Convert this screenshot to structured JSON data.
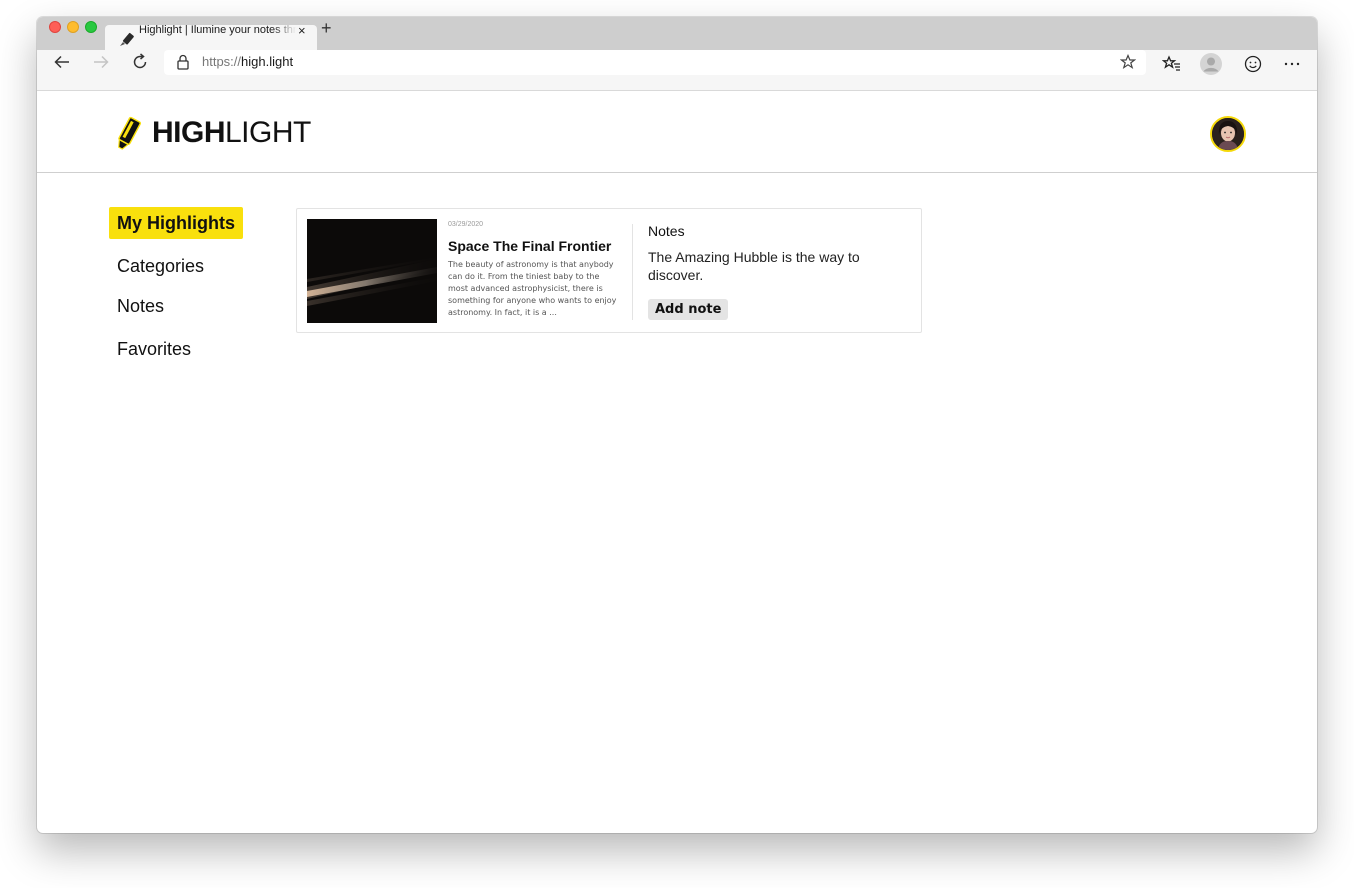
{
  "browser": {
    "tab": {
      "title": "Highlight | Ilumine your notes through your highlights",
      "close_glyph": "×"
    },
    "new_tab_glyph": "+",
    "address": {
      "scheme": "https://",
      "host": "high.light"
    },
    "icons": [
      "back-arrow-icon",
      "forward-arrow-icon",
      "reload-icon",
      "lock-icon",
      "star-icon",
      "favorites-icon",
      "profile-icon",
      "emoji-icon",
      "more-icon"
    ]
  },
  "header": {
    "logo_bold": "HIGH",
    "logo_light": "LIGHT",
    "accent_color": "#f9e00d"
  },
  "sidebar": {
    "items": [
      {
        "label": "My Highlights",
        "active": true
      },
      {
        "label": "Categories",
        "active": false
      },
      {
        "label": "Notes",
        "active": false
      },
      {
        "label": "Favorites",
        "active": false
      }
    ]
  },
  "highlight_card": {
    "date": "03/29/2020",
    "title": "Space The Final Frontier",
    "excerpt": "The beauty of astronomy is that anybody can do it. From the tiniest baby to the most advanced astrophysicist, there is something for anyone who wants to enjoy astronomy. In fact, it is a ...",
    "notes_heading": "Notes",
    "note_text": "The Amazing Hubble is the way to discover.",
    "add_note_label": "Add note"
  }
}
